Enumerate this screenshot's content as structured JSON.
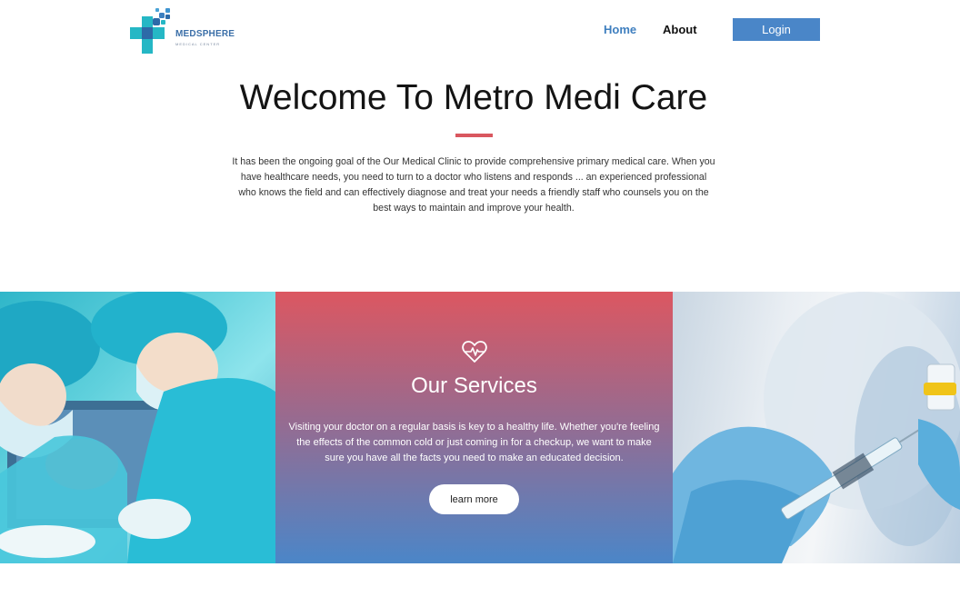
{
  "header": {
    "logo": {
      "name": "MEDSPHERE",
      "tagline": "MEDICAL CENTER",
      "icon": "medical-cross-icon",
      "colors": [
        "#25b7c5",
        "#2d6aa8"
      ]
    },
    "nav": {
      "home": "Home",
      "about": "About"
    },
    "login_label": "Login"
  },
  "welcome": {
    "title": "Welcome To Metro Medi Care",
    "text": "It has been the ongoing goal of the Our Medical Clinic to provide comprehensive primary medical care. When you have healthcare needs, you need to turn to a doctor who listens and responds ... an experienced professional who knows the field and can effectively diagnose and treat your needs a friendly staff who counsels you on the best ways to maintain and improve your health."
  },
  "services": {
    "icon": "heart-pulse-icon",
    "title": "Our Services",
    "text": "Visiting your doctor on a regular basis is key to a healthy life. Whether you're feeling the effects of the common cold or just coming in for a checkup, we want to make sure you have all the facts you need to make an educated decision.",
    "button": "learn more"
  },
  "colors": {
    "accent": "#4a86c8",
    "rule": "#d9575f",
    "gradient_top": "#dc5761",
    "gradient_bottom": "#4b86c8"
  }
}
